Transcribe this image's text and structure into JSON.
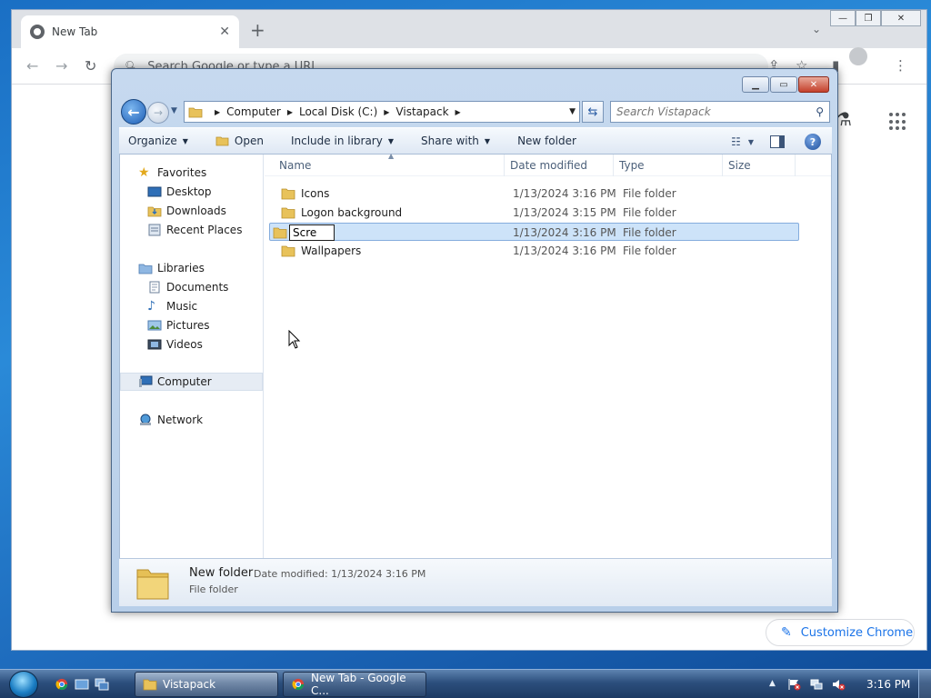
{
  "chrome": {
    "tab_title": "New Tab",
    "tab_close": "✕",
    "new_tab": "+",
    "chevron": "⌄",
    "omnibox_placeholder": "Search Google or type a URL",
    "customize_label": "Customize Chrome",
    "win_minimize": "—",
    "win_restore": "❐",
    "win_close": "✕"
  },
  "explorer": {
    "win_minimize": "▁",
    "win_restore": "▭",
    "win_close": "✕",
    "breadcrumbs": [
      "Computer",
      "Local Disk (C:)",
      "Vistapack"
    ],
    "search_placeholder": "Search Vistapack",
    "commands": {
      "organize": "Organize",
      "open": "Open",
      "include_in_library": "Include in library",
      "share_with": "Share with",
      "new_folder": "New folder"
    },
    "nav": {
      "favorites": "Favorites",
      "desktop": "Desktop",
      "downloads": "Downloads",
      "recent_places": "Recent Places",
      "libraries": "Libraries",
      "documents": "Documents",
      "music": "Music",
      "pictures": "Pictures",
      "videos": "Videos",
      "computer": "Computer",
      "network": "Network"
    },
    "columns": {
      "name": "Name",
      "date_modified": "Date modified",
      "type": "Type",
      "size": "Size"
    },
    "files": [
      {
        "name": "Icons",
        "date": "1/13/2024 3:16 PM",
        "type": "File folder"
      },
      {
        "name": "Logon background",
        "date": "1/13/2024 3:15 PM",
        "type": "File folder"
      },
      {
        "name": "Scre",
        "date": "1/13/2024 3:16 PM",
        "type": "File folder"
      },
      {
        "name": "Wallpapers",
        "date": "1/13/2024 3:16 PM",
        "type": "File folder"
      }
    ],
    "details": {
      "name": "New folder",
      "modified": "Date modified: 1/13/2024 3:16 PM",
      "type": "File folder"
    }
  },
  "taskbar": {
    "explorer_task": "Vistapack",
    "chrome_task": "New Tab - Google C...",
    "clock": "3:16 PM"
  },
  "colors": {
    "selection": "#cde3f9",
    "selection_border": "#84acdd",
    "chrome_accent": "#1a73e8",
    "folder": "#e8c25a"
  }
}
